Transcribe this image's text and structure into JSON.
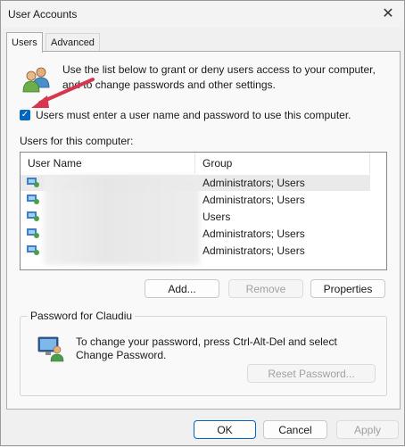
{
  "window": {
    "title": "User Accounts",
    "close_glyph": "✕"
  },
  "tabs": [
    {
      "label": "Users",
      "selected": true
    },
    {
      "label": "Advanced",
      "selected": false
    }
  ],
  "users_tab": {
    "intro_text": "Use the list below to grant or deny users access to your computer, and to change passwords and other settings.",
    "checkbox": {
      "label": "Users must enter a user name and password to use this computer.",
      "checked": true
    },
    "list_label": "Users for this computer:",
    "columns": [
      "User Name",
      "Group"
    ],
    "rows": [
      {
        "name": "",
        "group": "Administrators; Users",
        "selected": true
      },
      {
        "name": "",
        "group": "Administrators; Users",
        "selected": false
      },
      {
        "name": "",
        "group": "Users",
        "selected": false
      },
      {
        "name": "",
        "group": "Administrators; Users",
        "selected": false
      },
      {
        "name": "",
        "group": "Administrators; Users",
        "selected": false
      }
    ],
    "buttons": {
      "add": "Add...",
      "remove": "Remove",
      "properties": "Properties"
    },
    "password_group": {
      "legend": "Password for Claudiu",
      "text": "To change your password, press Ctrl-Alt-Del and select Change Password.",
      "reset_button": "Reset Password..."
    }
  },
  "footer": {
    "ok": "OK",
    "cancel": "Cancel",
    "apply": "Apply"
  },
  "colors": {
    "checkbox_accent": "#0067c0",
    "annotation_arrow": "#d6364e"
  }
}
